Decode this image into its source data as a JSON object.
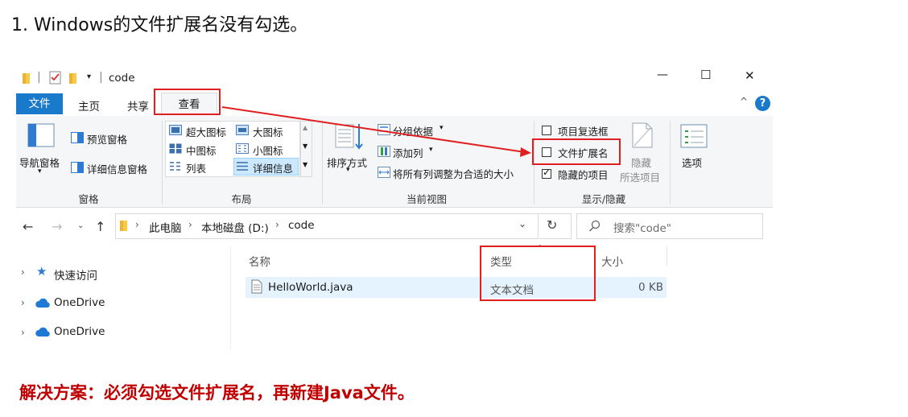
{
  "heading": "1.   Windows的文件扩展名没有勾选。",
  "window": {
    "title": "code",
    "controls": {
      "minimize": "—",
      "maximize": "☐",
      "close": "✕"
    }
  },
  "tabs": {
    "file": "文件",
    "home": "主页",
    "share": "共享",
    "view": "查看"
  },
  "help": "?",
  "ribbon": {
    "panes": {
      "nav_pane": "导航窗格",
      "preview_pane": "预览窗格",
      "details_pane": "详细信息窗格",
      "group_label": "窗格"
    },
    "layout": {
      "extra_large": "超大图标",
      "large": "大图标",
      "medium": "中图标",
      "small": "小图标",
      "list": "列表",
      "details": "详细信息",
      "group_label": "布局"
    },
    "current_view": {
      "sort_by": "排序方式",
      "group_by": "分组依据",
      "add_columns": "添加列",
      "size_all_columns": "将所有列调整为合适的大小",
      "group_label": "当前视图"
    },
    "show_hide": {
      "item_checkboxes": {
        "label": "项目复选框",
        "checked": false
      },
      "file_extensions": {
        "label": "文件扩展名",
        "checked": false
      },
      "hidden_items": {
        "label": "隐藏的项目",
        "checked": true
      },
      "hide_selected_line1": "隐藏",
      "hide_selected_line2": "所选项目",
      "group_label": "显示/隐藏"
    },
    "options": "选项"
  },
  "address": {
    "crumbs": [
      "此电脑",
      "本地磁盘 (D:)",
      "code"
    ],
    "search_placeholder": "搜索\"code\""
  },
  "sidebar": [
    {
      "label": "快速访问",
      "icon": "star-icon"
    },
    {
      "label": "OneDrive",
      "icon": "cloud-icon"
    },
    {
      "label": "OneDrive",
      "icon": "cloud-icon"
    }
  ],
  "columns": {
    "name": "名称",
    "type": "类型",
    "size": "大小"
  },
  "files": [
    {
      "name": "HelloWorld.java",
      "type": "文本文档",
      "size": "0 KB"
    }
  ],
  "solution": "解决方案：必须勾选文件扩展名，再新建Java文件。",
  "colors": {
    "annotation_red": "#e02020",
    "solution_red": "#c00000",
    "file_tab_blue": "#1979ca"
  }
}
